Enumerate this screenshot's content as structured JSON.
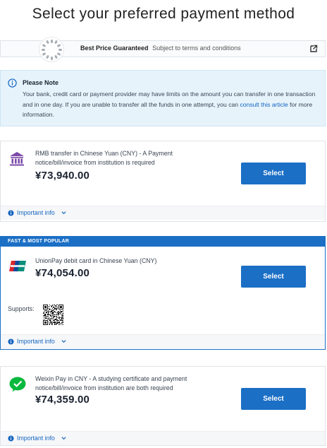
{
  "page": {
    "title": "Select your preferred payment method"
  },
  "guarantee": {
    "title": "Best Price Guaranteed",
    "subtitle": "Subject to terms and conditions",
    "icon": "external-link-icon"
  },
  "note": {
    "title": "Please Note",
    "body_1": "Your bank, credit card or payment provider may have limits on the amount you can transfer in one transaction and in one day. If you are unable to transfer all the funds in one attempt, you can",
    "link_1": "consult",
    "link_2": "this article",
    "body_2": "for more information."
  },
  "payment_methods": [
    {
      "description": "RMB transfer in Chinese Yuan (CNY) - A Payment notice/bill/invoice from institution is required",
      "price": "¥73,940.00",
      "button": "Select",
      "info_label": "Important info",
      "icon": "bank-icon"
    },
    {
      "banner": "FAST & MOST POPULAR",
      "description": "UnionPay debit card in Chinese Yuan (CNY)",
      "price": "¥74,054.00",
      "button": "Select",
      "supports_label": "Supports:",
      "info_label": "Important info",
      "icon": "unionpay-icon"
    },
    {
      "description": "Weixin Pay in CNY - A studying certificate and payment notice/bill/invoice from institution are both required",
      "price": "¥74,359.00",
      "button": "Select",
      "info_label": "Important info",
      "icon": "wechat-pay-icon"
    }
  ],
  "colors": {
    "primary": "#1b6fc5",
    "note_bg": "#e6f3fb",
    "link": "#1565c0",
    "wechat_green": "#09b83e",
    "unionpay_red": "#d7262e"
  }
}
